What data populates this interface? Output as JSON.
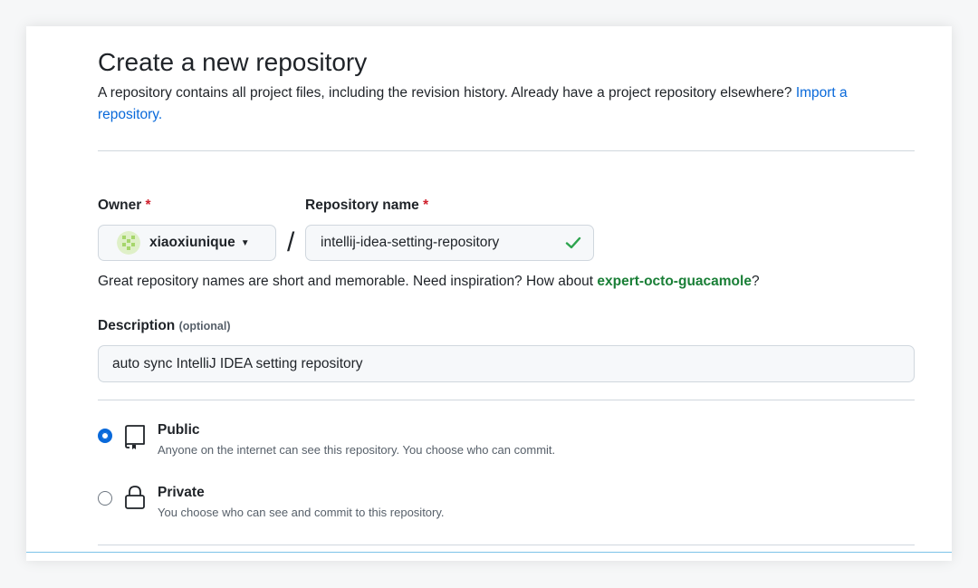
{
  "header": {
    "title": "Create a new repository",
    "subtitle_text": "A repository contains all project files, including the revision history. Already have a project repository elsewhere?",
    "import_link": "Import a repository."
  },
  "owner": {
    "label": "Owner",
    "required_mark": "*",
    "value": "xiaoxiunique"
  },
  "separator": "/",
  "repo_name": {
    "label": "Repository name",
    "required_mark": "*",
    "value": "intellij-idea-setting-repository"
  },
  "hint": {
    "prefix": "Great repository names are short and memorable. Need inspiration? How about",
    "suggestion": "expert-octo-guacamole",
    "suffix": "?"
  },
  "description": {
    "label": "Description",
    "optional": "(optional)",
    "value": "auto sync IntelliJ IDEA setting repository"
  },
  "visibility": [
    {
      "title": "Public",
      "desc": "Anyone on the internet can see this repository. You choose who can commit.",
      "checked": true,
      "icon": "repo-icon"
    },
    {
      "title": "Private",
      "desc": "You choose who can see and commit to this repository.",
      "checked": false,
      "icon": "lock-icon"
    }
  ],
  "colors": {
    "link": "#0969da",
    "success": "#1a7f37",
    "required": "#cf222e"
  }
}
